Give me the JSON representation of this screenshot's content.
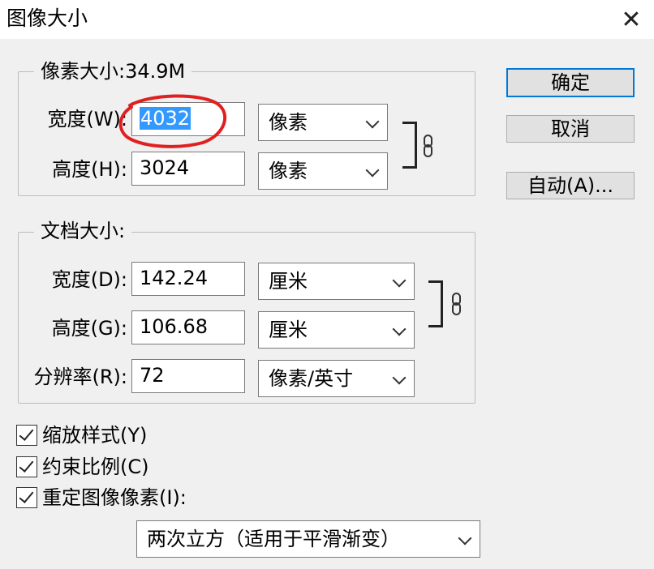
{
  "window": {
    "title": "图像大小",
    "close_glyph": "✕"
  },
  "pixel_dimensions": {
    "legend": "像素大小:34.9M",
    "width_label": "宽度(W):",
    "width_value": "4032",
    "width_unit": "像素",
    "height_label": "高度(H):",
    "height_value": "3024",
    "height_unit": "像素"
  },
  "document_size": {
    "legend": "文档大小:",
    "width_label": "宽度(D):",
    "width_value": "142.24",
    "width_unit": "厘米",
    "height_label": "高度(G):",
    "height_value": "106.68",
    "height_unit": "厘米",
    "resolution_label": "分辨率(R):",
    "resolution_value": "72",
    "resolution_unit": "像素/英寸"
  },
  "buttons": {
    "ok": "确定",
    "cancel": "取消",
    "auto": "自动(A)..."
  },
  "options": {
    "scale_styles": {
      "label": "缩放样式(Y)",
      "checked": true
    },
    "constrain_proportions": {
      "label": "约束比例(C)",
      "checked": true
    },
    "resample": {
      "label": "重定图像像素(I):",
      "checked": true
    },
    "resample_method": "两次立方（适用于平滑渐变）"
  },
  "colors": {
    "selection": "#3399ff",
    "annotation_circle": "#e02020",
    "default_button_border": "#0078d7"
  },
  "icons": {
    "link": "chain-link-icon",
    "dropdown": "chevron-down-icon",
    "close": "close-icon"
  }
}
